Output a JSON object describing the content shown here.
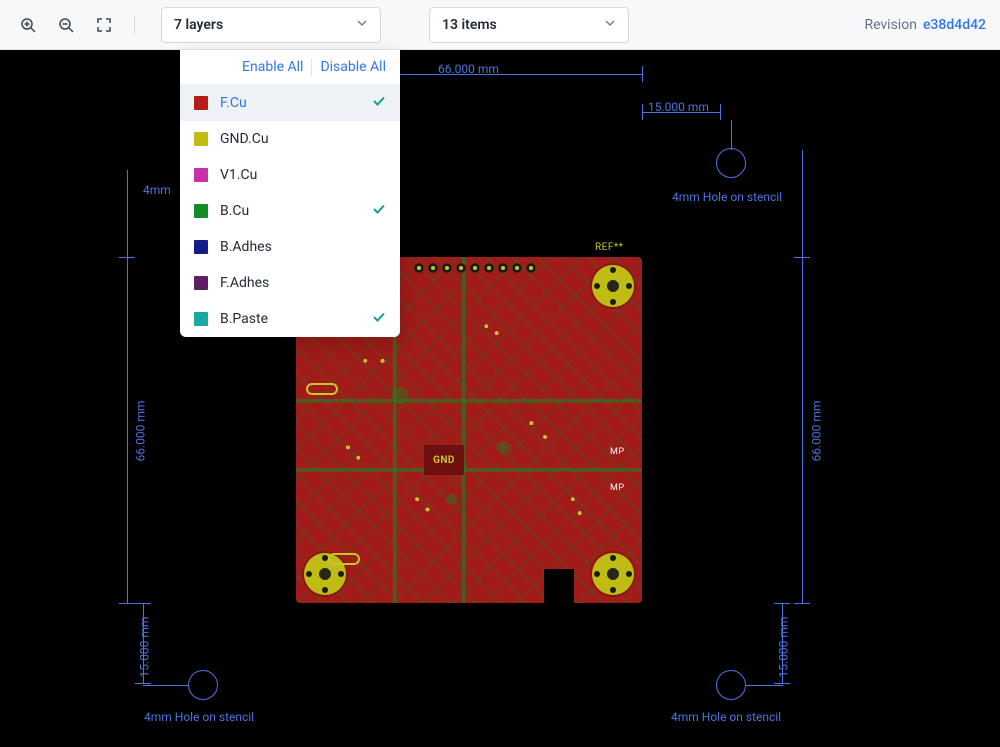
{
  "toolbar": {
    "layers_label": "7 layers",
    "items_label": "13 items",
    "revision_label": "Revision",
    "revision_hash": "e38d4d42"
  },
  "layers_panel": {
    "enable_all": "Enable All",
    "disable_all": "Disable All",
    "layers": [
      {
        "name": "F.Cu",
        "color": "#b31c18",
        "checked": true,
        "selected": true
      },
      {
        "name": "GND.Cu",
        "color": "#bfbc15",
        "checked": false,
        "selected": false
      },
      {
        "name": "V1.Cu",
        "color": "#c92fa9",
        "checked": false,
        "selected": false
      },
      {
        "name": "B.Cu",
        "color": "#158a2b",
        "checked": true,
        "selected": false
      },
      {
        "name": "B.Adhes",
        "color": "#121a87",
        "checked": false,
        "selected": false
      },
      {
        "name": "F.Adhes",
        "color": "#5d1e66",
        "checked": false,
        "selected": false
      },
      {
        "name": "B.Paste",
        "color": "#1aa9a0",
        "checked": true,
        "selected": false
      }
    ]
  },
  "canvas": {
    "dim_66_top": "66.000 mm",
    "dim_15_top": "15.000 mm",
    "dim_66_left": "66.000 mm",
    "dim_66_right": "66.000 mm",
    "dim_4mm_left": "4mm",
    "dim_15_bl": "15.000 mm",
    "dim_15_br": "15.000 mm",
    "hole_label_tr": "4mm Hole on stencil",
    "hole_label_bl": "4mm Hole on stencil",
    "hole_label_br": "4mm Hole on stencil",
    "ref": "REF**",
    "gnd": "GND",
    "mp1": "MP",
    "mp2": "MP"
  }
}
